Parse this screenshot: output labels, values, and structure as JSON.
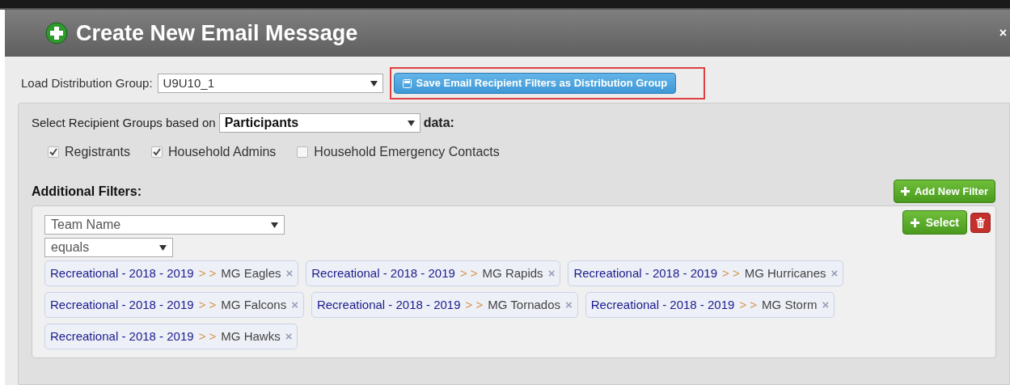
{
  "dialog": {
    "title": "Create New Email Message",
    "close": "×"
  },
  "distribution_group": {
    "label": "Load Distribution Group:",
    "value": "U9U10_1"
  },
  "save_button": {
    "label": "Save Email Recipient Filters as Distribution Group",
    "highlighted": true
  },
  "recipient_groups": {
    "label": "Select Recipient Groups based on",
    "value": "Participants",
    "suffix": "data:",
    "options": [
      {
        "label": "Registrants",
        "checked": true
      },
      {
        "label": "Household Admins",
        "checked": true
      },
      {
        "label": "Household Emergency Contacts",
        "checked": false
      }
    ]
  },
  "additional_filters": {
    "label": "Additional Filters:",
    "add_button": "Add New Filter",
    "filters": [
      {
        "field": "Team Name",
        "operator": "equals",
        "select_button": "Select",
        "values": [
          {
            "group": "Recreational - 2018 - 2019",
            "separator": "> >",
            "team": "MG Eagles",
            "remove": "×"
          },
          {
            "group": "Recreational - 2018 - 2019",
            "separator": "> >",
            "team": "MG Rapids",
            "remove": "×"
          },
          {
            "group": "Recreational - 2018 - 2019",
            "separator": "> >",
            "team": "MG Hurricanes",
            "remove": "×"
          },
          {
            "group": "Recreational - 2018 - 2019",
            "separator": "> >",
            "team": "MG Falcons",
            "remove": "×"
          },
          {
            "group": "Recreational - 2018 - 2019",
            "separator": "> >",
            "team": "MG Tornados",
            "remove": "×"
          },
          {
            "group": "Recreational - 2018 - 2019",
            "separator": "> >",
            "team": "MG Storm",
            "remove": "×"
          },
          {
            "group": "Recreational - 2018 - 2019",
            "separator": "> >",
            "team": "MG Hawks",
            "remove": "×"
          }
        ]
      }
    ]
  }
}
